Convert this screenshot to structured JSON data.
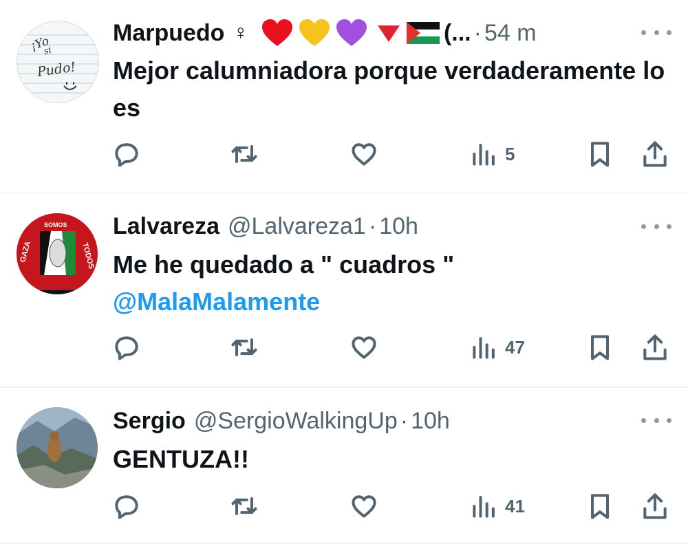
{
  "tweets": [
    {
      "name": "Marpuedo",
      "handle": "",
      "name_suffix": "♀",
      "badges": [
        "❤",
        "💛",
        "💜",
        "🔻",
        "🇵🇸"
      ],
      "name_truncated": "(...",
      "time": "54 m",
      "text": "Mejor calumniadora porque verdaderamente lo es",
      "mention": "",
      "views": "5",
      "avatar_text": [
        "¡Yo",
        "si",
        "Pudo!"
      ]
    },
    {
      "name": "Lalvareza",
      "handle": "@Lalvareza1",
      "time": "10h",
      "text": "Me he quedado a \" cuadros \"",
      "mention": "@MalaMalamente",
      "views": "47",
      "avatar_text": [
        "GAZA",
        "SOMOS",
        "TODOS"
      ]
    },
    {
      "name": "Sergio",
      "handle": "@SergioWalkingUp",
      "time": "10h",
      "text": "GENTUZA!!",
      "mention": "",
      "views": "41"
    }
  ],
  "icons": [
    "reply-icon",
    "retweet-icon",
    "like-icon",
    "views-icon",
    "bookmark-icon",
    "share-icon"
  ],
  "colors": {
    "text": "#0f1419",
    "muted": "#536471",
    "mention": "#1d9bf0",
    "divider": "#eff3f4"
  }
}
